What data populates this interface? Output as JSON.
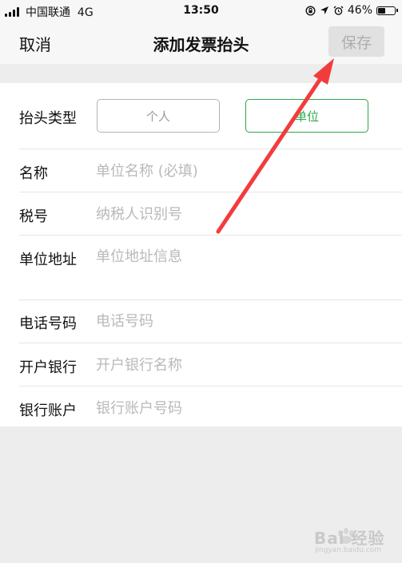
{
  "status_bar": {
    "carrier": "中国联通",
    "network": "4G",
    "time": "13:50",
    "battery": "46%",
    "battery_level": 0.46,
    "icons": [
      "signal-icon",
      "lock-rotation-icon",
      "location-icon",
      "alarm-icon",
      "battery-icon"
    ]
  },
  "nav": {
    "cancel": "取消",
    "title": "添加发票抬头",
    "save": "保存"
  },
  "form": {
    "type_label": "抬头类型",
    "type_options": {
      "person": "个人",
      "unit": "单位"
    },
    "selected_type": "单位",
    "fields": {
      "name": {
        "label": "名称",
        "placeholder": "单位名称 (必填)"
      },
      "tax": {
        "label": "税号",
        "placeholder": "纳税人识别号"
      },
      "address": {
        "label": "单位地址",
        "placeholder": "单位地址信息"
      },
      "phone": {
        "label": "电话号码",
        "placeholder": "电话号码"
      },
      "bank": {
        "label": "开户银行",
        "placeholder": "开户银行名称"
      },
      "account": {
        "label": "银行账户",
        "placeholder": "银行账户号码"
      }
    }
  },
  "colors": {
    "accent": "#2ba84a",
    "annotation_arrow": "#f23c3c",
    "page_bg": "#ededed"
  },
  "watermark": {
    "text": "Bai 经验",
    "sub": "jingyan.baidu.com"
  }
}
